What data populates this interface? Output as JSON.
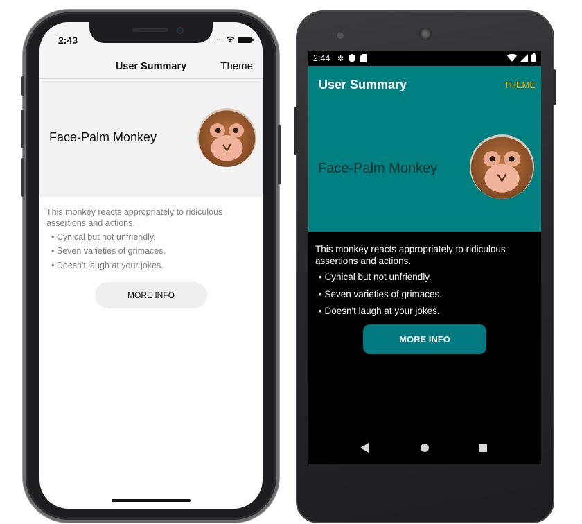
{
  "ios": {
    "status": {
      "time": "2:43"
    },
    "navbar": {
      "title": "User Summary",
      "theme_label": "Theme"
    },
    "header": {
      "name": "Face-Palm Monkey"
    },
    "description": "This monkey reacts appropriately to ridiculous assertions and actions.",
    "bullets": [
      "• Cynical but not unfriendly.",
      "• Seven varieties of grimaces.",
      "• Doesn't laugh at your jokes."
    ],
    "more_info_label": "MORE INFO"
  },
  "android": {
    "status": {
      "time": "2:44"
    },
    "toolbar": {
      "title": "User Summary",
      "theme_label": "THEME"
    },
    "header": {
      "name": "Face-Palm Monkey"
    },
    "description": "This monkey reacts appropriately to ridiculous assertions and actions.",
    "bullets": [
      "• Cynical but not unfriendly.",
      "• Seven varieties of grimaces.",
      "• Doesn't laugh at your jokes."
    ],
    "more_info_label": "MORE INFO"
  },
  "colors": {
    "android_primary": "#008080",
    "android_accent": "#f5a500",
    "ios_header_bg": "#f2f2f2",
    "ios_text_secondary": "#7a7a7a"
  },
  "icons": {
    "ios_status": [
      "signal-dots-icon",
      "wifi-icon",
      "battery-icon"
    ],
    "android_status_left": [
      "settings-icon",
      "shield-icon",
      "sd-card-icon"
    ],
    "android_status_right": [
      "wifi-icon",
      "cell-signal-icon",
      "battery-icon"
    ],
    "android_navbar": [
      "back-icon",
      "home-icon",
      "recents-icon"
    ]
  }
}
